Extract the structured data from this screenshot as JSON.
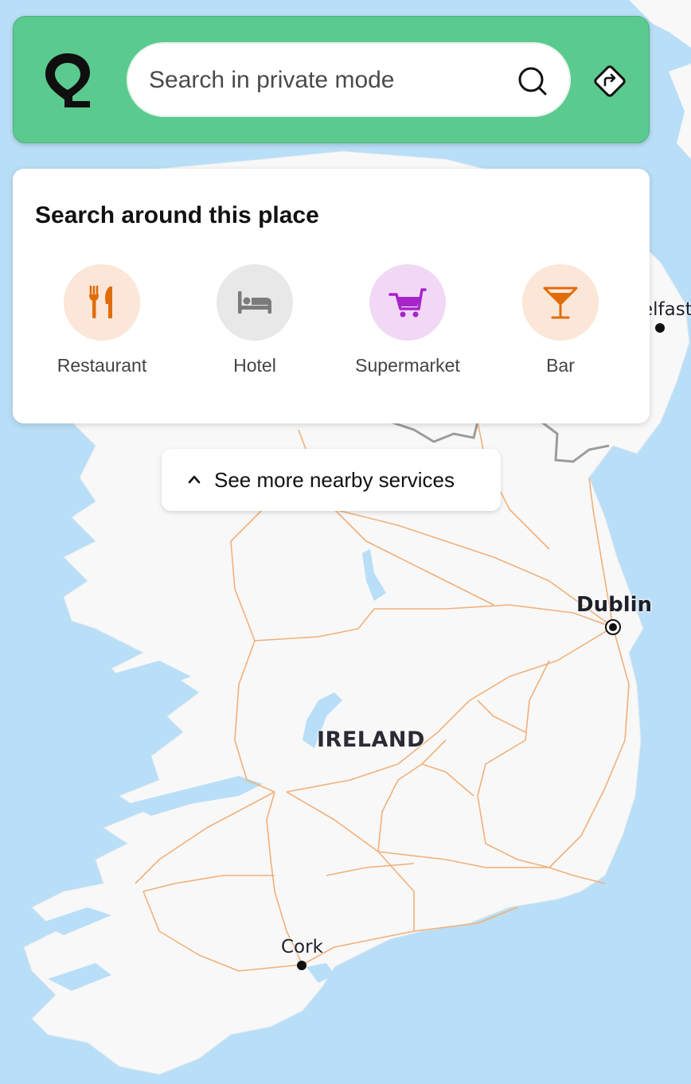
{
  "search": {
    "placeholder": "Search in private mode"
  },
  "nearby": {
    "title": "Search around this place",
    "categories": [
      {
        "label": "Restaurant",
        "icon": "fork-knife-icon",
        "bg": "#fbe6d8",
        "color": "#e06c0a"
      },
      {
        "label": "Hotel",
        "icon": "bed-icon",
        "bg": "#e8e8e8",
        "color": "#7b7b7b"
      },
      {
        "label": "Supermarket",
        "icon": "shopping-cart-icon",
        "bg": "#f1d9f5",
        "color": "#a724c9"
      },
      {
        "label": "Bar",
        "icon": "cocktail-glass-icon",
        "bg": "#fbe6d8",
        "color": "#e06c0a"
      }
    ],
    "see_more": "See more nearby services"
  },
  "map": {
    "country_label": "IRELAND",
    "cities": {
      "dublin": "Dublin",
      "cork": "Cork",
      "belfast": "elfast"
    }
  },
  "colors": {
    "header_bg": "#5bca8e",
    "sea": "#b9def7",
    "land": "#f8f8f8",
    "roads": "#f1b07a",
    "border": "#9c9c9c"
  }
}
